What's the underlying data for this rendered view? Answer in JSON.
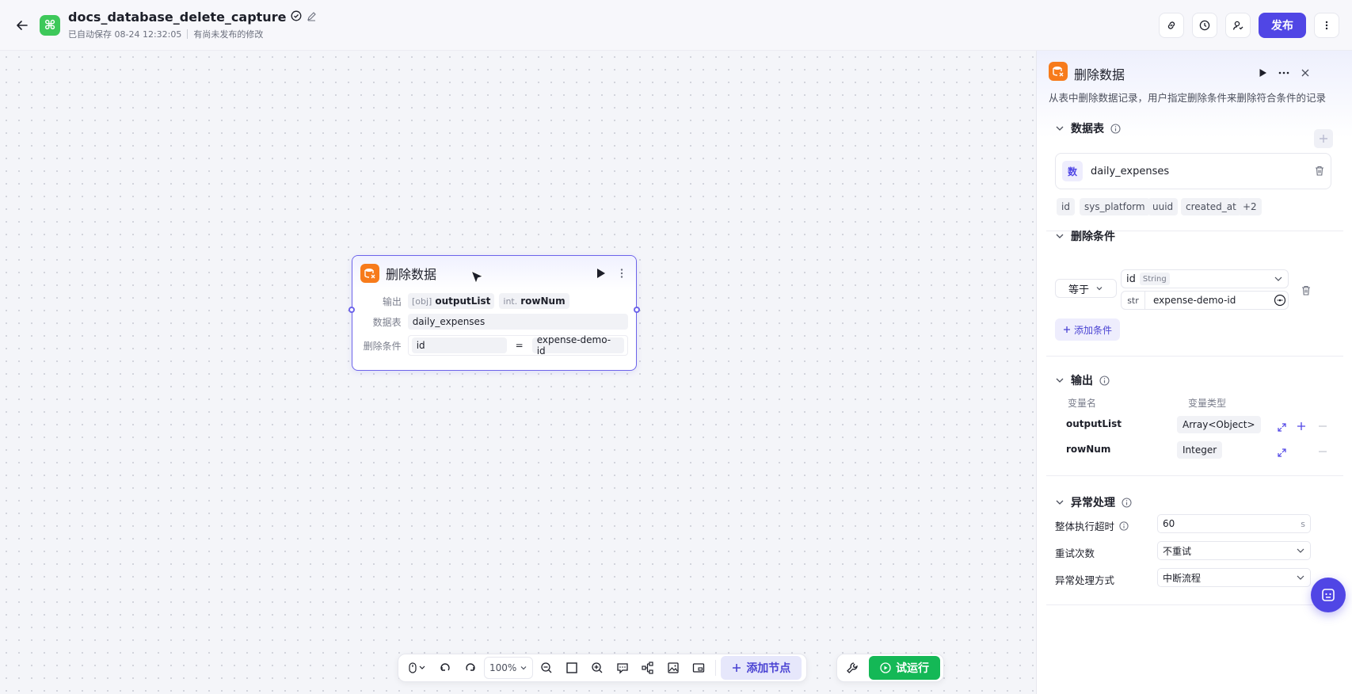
{
  "header": {
    "title": "docs_database_delete_capture",
    "autosave": "已自动保存 08-24 12:32:05",
    "unpublished": "有尚未发布的修改",
    "publish_label": "发布",
    "app_icon_glyph": "⌘"
  },
  "node": {
    "title": "删除数据",
    "output_label": "输出",
    "outputs": [
      {
        "type": "[obj]",
        "name": "outputList"
      },
      {
        "type": "int.",
        "name": "rowNum"
      }
    ],
    "table_label": "数据表",
    "table_value": "daily_expenses",
    "cond_label": "删除条件",
    "cond_field": "id",
    "cond_op": "=",
    "cond_value": "expense-demo-id"
  },
  "toolbar": {
    "zoom": "100%",
    "add_node": "添加节点",
    "test_run": "试运行"
  },
  "panel": {
    "title": "删除数据",
    "description": "从表中删除数据记录，用户指定删除条件来删除符合条件的记录",
    "table_section": "数据表",
    "table_badge": "数",
    "table_name": "daily_expenses",
    "columns": [
      "id",
      "sys_platform",
      "uuid",
      "created_at",
      "+2"
    ],
    "cond_section": "删除条件",
    "cond_operator": "等于",
    "cond_field": "id",
    "cond_field_type": "String",
    "cond_value_type": "str",
    "cond_value": "expense-demo-id",
    "add_condition": "添加条件",
    "output_section": "输出",
    "var_name_header": "变量名",
    "var_type_header": "变量类型",
    "outputs": [
      {
        "name": "outputList",
        "type": "Array<Object>"
      },
      {
        "name": "rowNum",
        "type": "Integer"
      }
    ],
    "error_section": "异常处理",
    "timeout_label": "整体执行超时",
    "timeout_value": "60",
    "timeout_unit": "s",
    "retry_label": "重试次数",
    "retry_value": "不重试",
    "error_mode_label": "异常处理方式",
    "error_mode_value": "中断流程"
  },
  "colors": {
    "accent": "#5046e5",
    "run_green": "#14b856",
    "db_orange": "#f77b1b",
    "app_green": "#3ec85a"
  }
}
